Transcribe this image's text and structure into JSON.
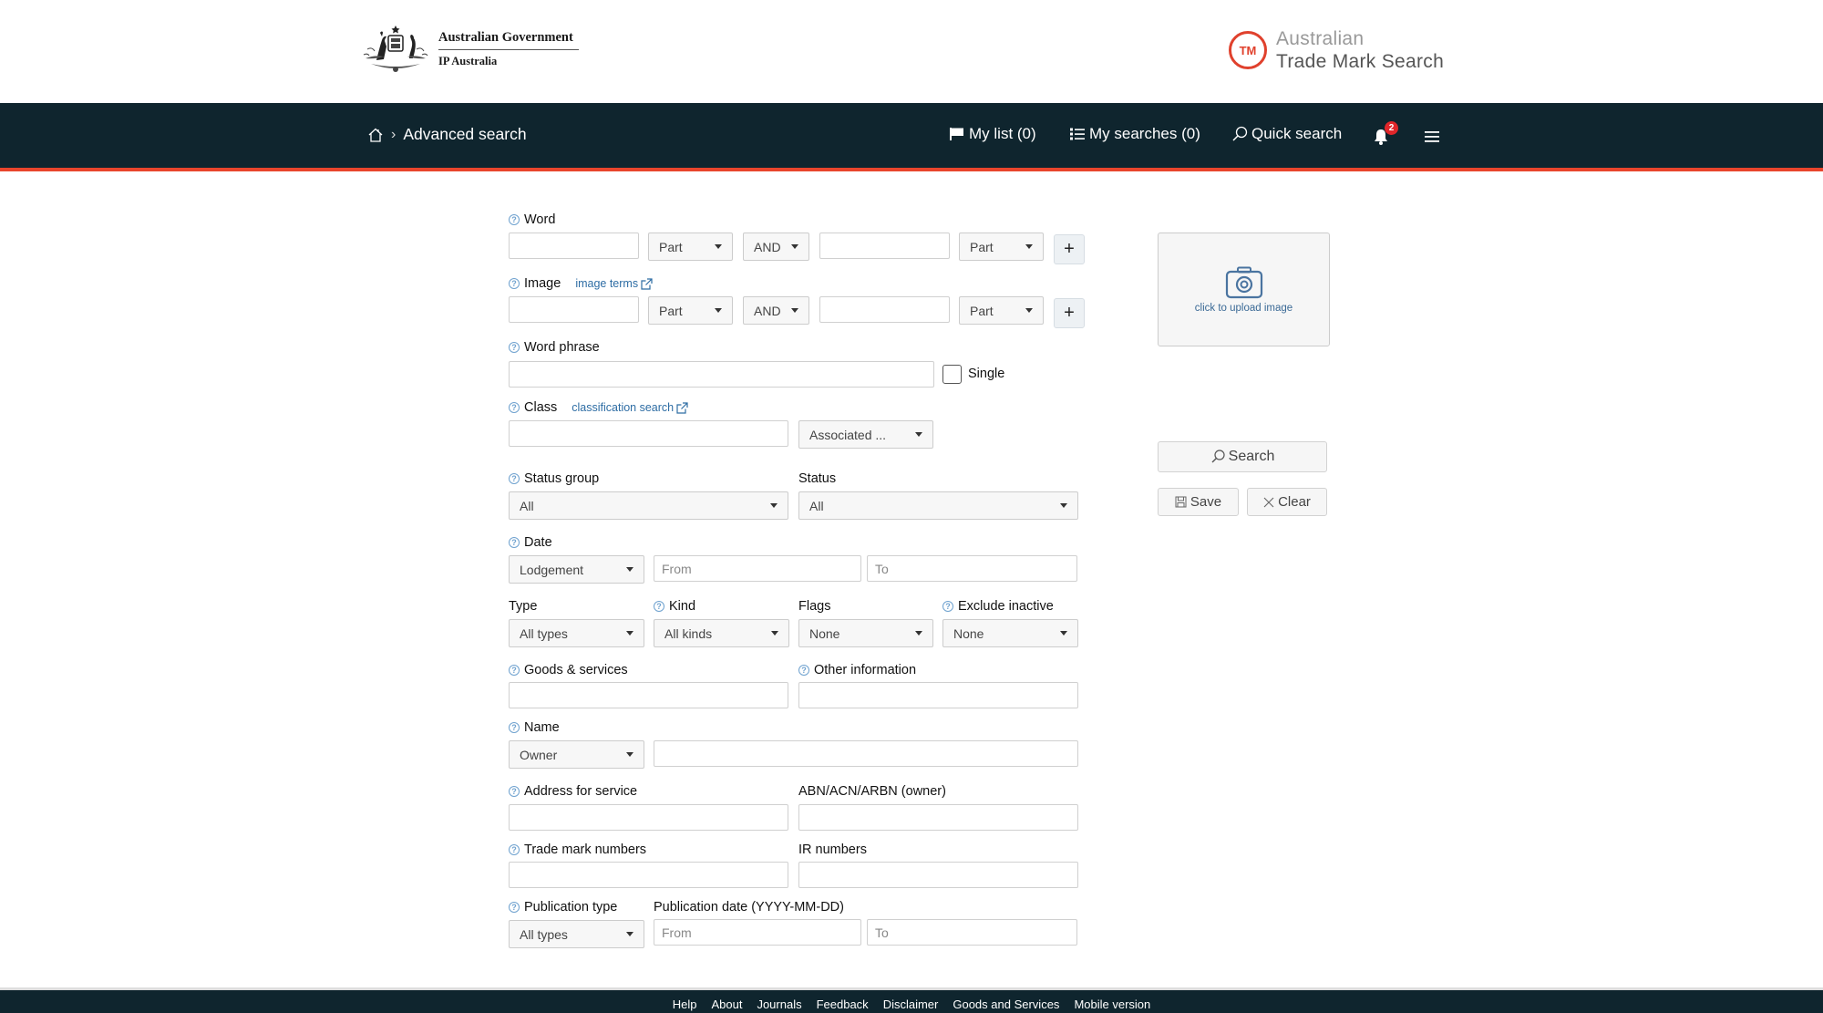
{
  "header": {
    "gov_line1": "Australian Government",
    "gov_line2": "IP Australia",
    "app_logo_badge": "TM",
    "app_title_line1": "Australian",
    "app_title_line2": "Trade Mark Search"
  },
  "nav": {
    "breadcrumb_current": "Advanced search",
    "my_list": "My list (0)",
    "my_searches": "My searches (0)",
    "quick_search": "Quick search",
    "notification_count": "2"
  },
  "form": {
    "word": {
      "label": "Word",
      "match1": "Part",
      "operator": "AND",
      "match2": "Part",
      "add": "+"
    },
    "image": {
      "label": "Image",
      "link": "image terms",
      "match1": "Part",
      "operator": "AND",
      "match2": "Part",
      "add": "+"
    },
    "word_phrase": {
      "label": "Word phrase",
      "single_label": "Single",
      "single_checked": false
    },
    "class": {
      "label": "Class",
      "link": "classification search",
      "select": "Associated ..."
    },
    "status_group": {
      "label": "Status group",
      "value": "All"
    },
    "status": {
      "label": "Status",
      "value": "All"
    },
    "date": {
      "label": "Date",
      "type": "Lodgement",
      "from_placeholder": "From",
      "to_placeholder": "To"
    },
    "type": {
      "label": "Type",
      "value": "All types"
    },
    "kind": {
      "label": "Kind",
      "value": "All kinds"
    },
    "flags": {
      "label": "Flags",
      "value": "None"
    },
    "exclude_inactive": {
      "label": "Exclude inactive",
      "value": "None"
    },
    "goods_services": {
      "label": "Goods & services"
    },
    "other_information": {
      "label": "Other information"
    },
    "name": {
      "label": "Name",
      "type": "Owner"
    },
    "address_for_service": {
      "label": "Address for service"
    },
    "abn": {
      "label": "ABN/ACN/ARBN (owner)"
    },
    "trade_mark_numbers": {
      "label": "Trade mark numbers"
    },
    "ir_numbers": {
      "label": "IR numbers"
    },
    "publication_type": {
      "label": "Publication type",
      "value": "All types"
    },
    "publication_date": {
      "label": "Publication date (YYYY-MM-DD)",
      "from_placeholder": "From",
      "to_placeholder": "To"
    }
  },
  "side": {
    "upload_text": "click to upload image",
    "search": "Search",
    "save": "Save",
    "clear": "Clear"
  },
  "footer": {
    "links": [
      "Help",
      "About",
      "Journals",
      "Feedback",
      "Disclaimer",
      "Goods and Services",
      "Mobile version"
    ]
  },
  "colors": {
    "navbar": "#0f252e",
    "accent": "#e8452c",
    "link": "#2e6da4",
    "help_icon": "#6fa2cf"
  }
}
